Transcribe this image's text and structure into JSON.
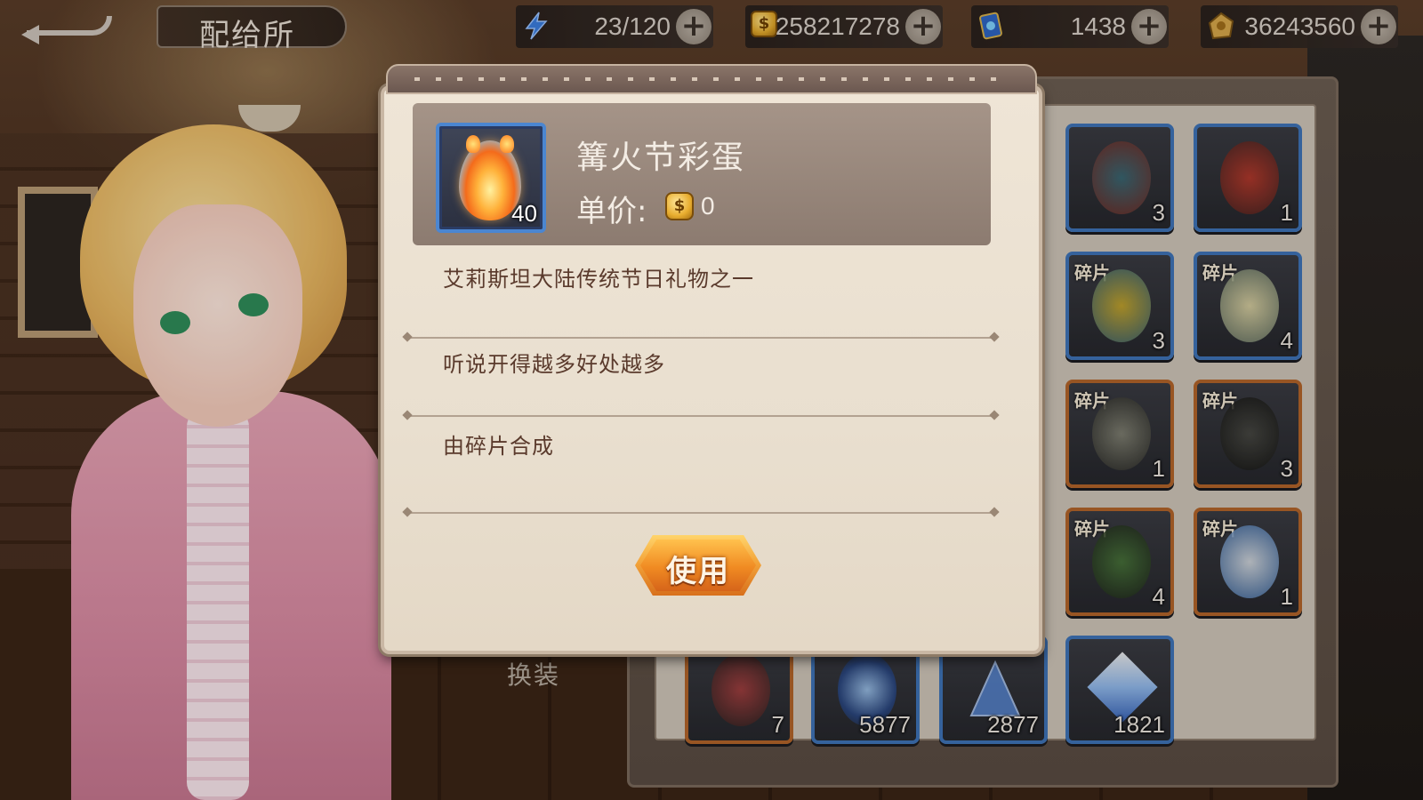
{
  "topbar": {
    "title": "配给所",
    "stamina": "23/120",
    "gold": "258217278",
    "diamonds": "1438",
    "tokens": "36243560"
  },
  "modal": {
    "item_name": "篝火节彩蛋",
    "item_quantity": "40",
    "price_label": "单价:",
    "price_value": "0",
    "descriptions": [
      "艾莉斯坦大陆传统节日礼物之一",
      "听说开得越多好处越多",
      "由碎片合成"
    ],
    "use_button_label": "使用"
  },
  "inventory": {
    "fragment_tag": "碎片",
    "slots": [
      {
        "count": "3",
        "rarity": "blue",
        "tagged": true
      },
      {
        "count": "1",
        "rarity": "blue",
        "tagged": true
      },
      {
        "count": "3",
        "rarity": "blue",
        "tagged": true
      },
      {
        "count": "4",
        "rarity": "blue",
        "tagged": true
      },
      {
        "count": "1",
        "rarity": "orange",
        "tagged": true
      },
      {
        "count": "3",
        "rarity": "orange",
        "tagged": true
      },
      {
        "count": "4",
        "rarity": "orange",
        "tagged": true
      },
      {
        "count": "1",
        "rarity": "orange",
        "tagged": true
      },
      {
        "count": "7",
        "rarity": "orange",
        "tagged": false
      },
      {
        "count": "5877",
        "rarity": "blue",
        "tagged": false
      },
      {
        "count": "2877",
        "rarity": "blue",
        "tagged": false
      },
      {
        "count": "1821",
        "rarity": "blue",
        "tagged": false
      }
    ]
  },
  "dress_label": "换装",
  "colors": {
    "accent_orange": "#f08a22",
    "slot_blue": "#3f74b8",
    "slot_orange": "#b3642a",
    "modal_bg": "#efe5d6",
    "desc_text": "#5a3a2c"
  }
}
